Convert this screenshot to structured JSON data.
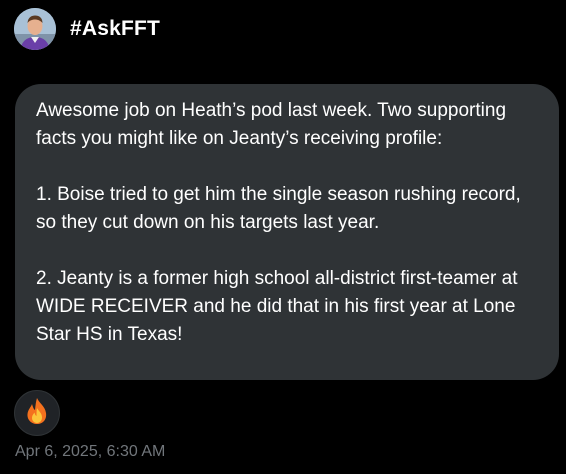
{
  "conversation": {
    "title": "#AskFFT",
    "avatar_icon": "person-avatar-icon"
  },
  "message": {
    "paragraphs": [
      "Awesome job on Heath’s pod last week. Two supporting facts you might like on Jeanty’s receiving profile:",
      "1. Boise tried to get him the single season rushing record, so they cut down on his targets last year.",
      "2. Jeanty is a former high school all-district first-teamer at WIDE RECEIVER and he did that in his first year at Lone Star HS in Texas!"
    ],
    "reaction_icon": "fire-emoji-icon",
    "timestamp": "Apr 6, 2025, 6:30 AM"
  },
  "colors": {
    "background": "#000000",
    "bubble": "#2f3336",
    "text": "#ffffff",
    "muted": "#71767b"
  }
}
